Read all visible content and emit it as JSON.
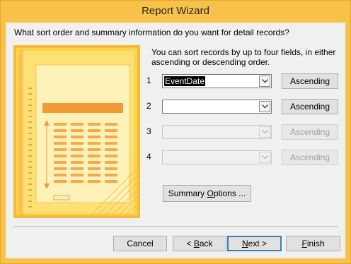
{
  "window": {
    "title": "Report Wizard"
  },
  "prompt": "What sort order and summary information do you want for detail records?",
  "description": "You can sort records by up to four fields, in either ascending or descending order.",
  "sort_rows": [
    {
      "number": "1",
      "field": "EventDate",
      "order": "Ascending",
      "enabled": true
    },
    {
      "number": "2",
      "field": "",
      "order": "Ascending",
      "enabled": true
    },
    {
      "number": "3",
      "field": "",
      "order": "Ascending",
      "enabled": false
    },
    {
      "number": "4",
      "field": "",
      "order": "Ascending",
      "enabled": false
    }
  ],
  "summary_button": {
    "pre": "Summary ",
    "accel": "O",
    "post": "ptions ..."
  },
  "footer": {
    "cancel": "Cancel",
    "back": {
      "pre": "< ",
      "accel": "B",
      "post": "ack"
    },
    "next": {
      "accel": "N",
      "post": "ext >"
    },
    "finish": {
      "accel": "F",
      "post": "inish"
    }
  },
  "colors": {
    "title_bar": "#f8c24a",
    "panel": "#f0f0f0",
    "illustration_bg": "#fbd54e",
    "illustration_accent": "#f29a3a"
  },
  "icons": [
    "dropdown-arrow-icon",
    "report-illustration"
  ]
}
